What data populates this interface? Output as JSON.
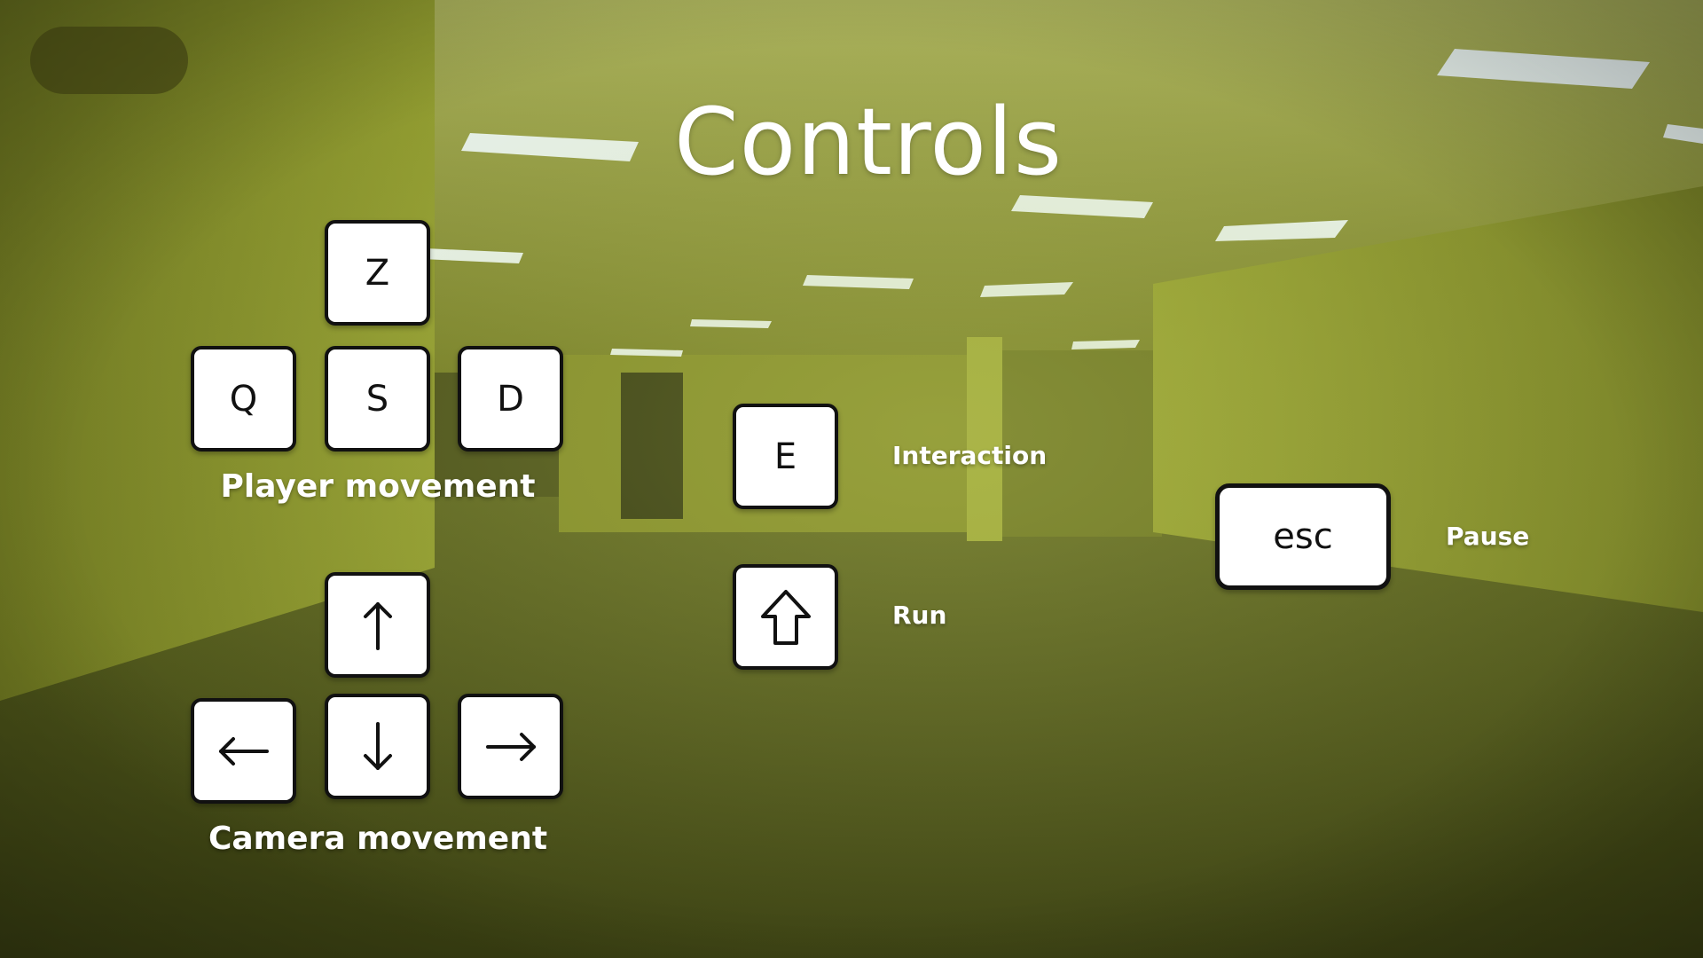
{
  "screen": {
    "title": "Controls"
  },
  "player_movement": {
    "label": "Player movement",
    "keys": {
      "up": "Z",
      "left": "Q",
      "down": "S",
      "right": "D"
    }
  },
  "camera_movement": {
    "label": "Camera movement",
    "keys": {
      "up": "arrow-up-icon",
      "left": "arrow-left-icon",
      "down": "arrow-down-icon",
      "right": "arrow-right-icon"
    }
  },
  "actions": [
    {
      "key": "E",
      "label": "Interaction"
    },
    {
      "key": "shift-arrow-icon",
      "label": "Run"
    },
    {
      "key": "esc",
      "label": "Pause"
    }
  ],
  "colors": {
    "key_face": "#ffffff",
    "key_border": "#111111",
    "text": "#ffffff",
    "wall": "#8a9425",
    "floor": "#4a5218"
  }
}
